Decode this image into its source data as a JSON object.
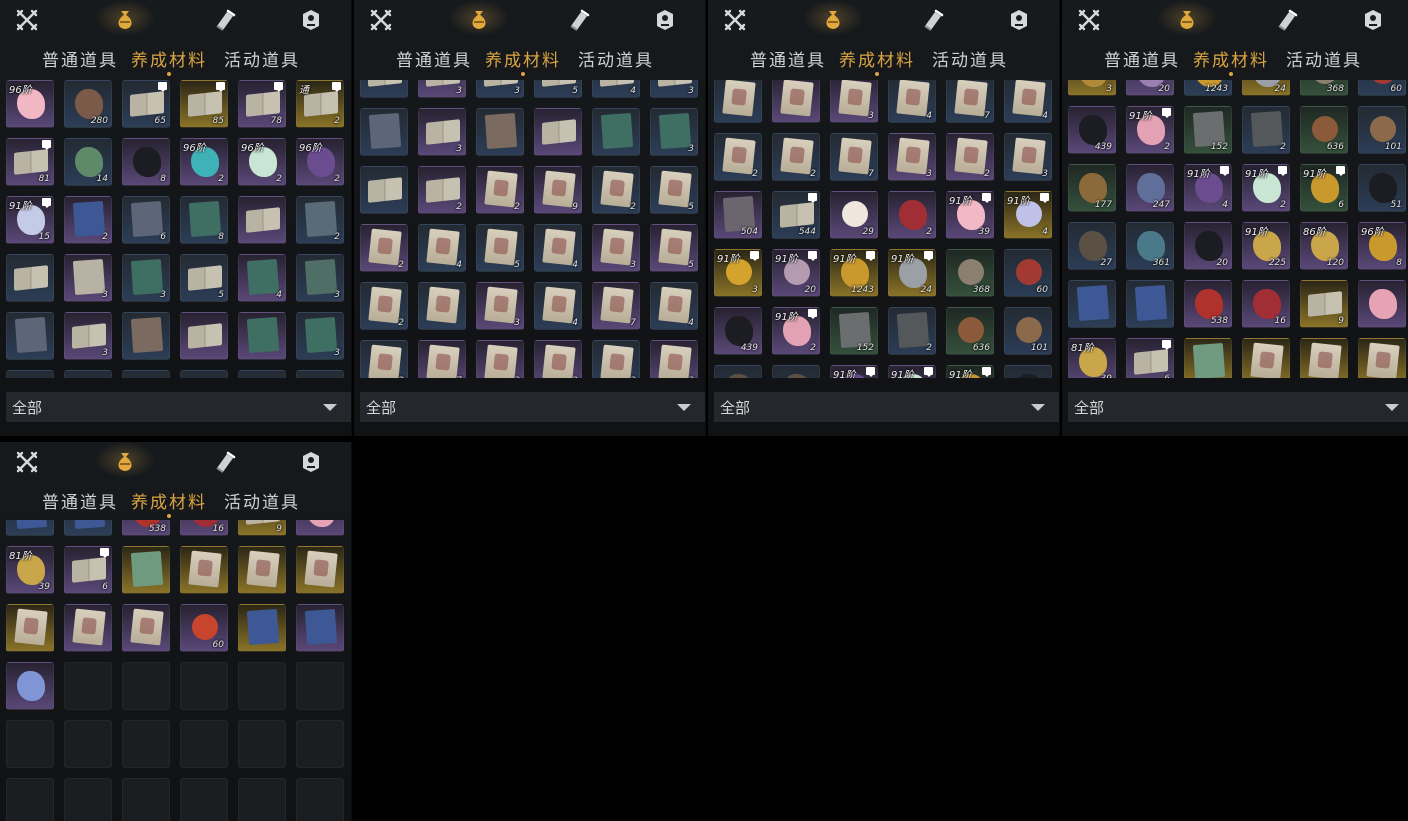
{
  "tabs": [
    "普通道具",
    "养成材料",
    "活动道具"
  ],
  "active_tab": 1,
  "top_icons": [
    {
      "name": "crossed-swords-icon"
    },
    {
      "name": "pouch-icon",
      "active": true
    },
    {
      "name": "scroll-brush-icon"
    },
    {
      "name": "shield-badge-icon"
    }
  ],
  "filter_label": "全部",
  "colors": {
    "active": "#d9a441",
    "text": "#cfd2d4",
    "panel_bg": "#15181b"
  },
  "panels": [
    {
      "items": [
        {
          "r": "purple",
          "a": "blob",
          "c": "#f2b7c4",
          "tier": "96阶"
        },
        {
          "r": "blue",
          "a": "blob",
          "c": "#7b5a49",
          "n": "280"
        },
        {
          "r": "blue",
          "a": "book",
          "n": "65",
          "badge": true
        },
        {
          "r": "gold",
          "a": "book",
          "n": "85",
          "badge": true
        },
        {
          "r": "purple",
          "a": "book",
          "n": "78",
          "badge": true
        },
        {
          "r": "gold",
          "a": "book",
          "n": "2",
          "badge": true,
          "tier": "通"
        },
        {
          "r": "purple",
          "a": "book",
          "n": "81",
          "badge": true
        },
        {
          "r": "blue",
          "a": "blob",
          "c": "#5f8a6a",
          "n": "14"
        },
        {
          "r": "purple",
          "a": "blob",
          "c": "#1b1d22",
          "n": "8"
        },
        {
          "r": "purple",
          "a": "blob",
          "c": "#3fb2b7",
          "n": "2",
          "tier": "96阶"
        },
        {
          "r": "purple",
          "a": "blob",
          "c": "#c9e6d4",
          "n": "2",
          "tier": "96阶"
        },
        {
          "r": "purple",
          "a": "blob",
          "c": "#6b4c8f",
          "n": "2",
          "tier": "96阶"
        },
        {
          "r": "purple",
          "a": "blob",
          "c": "#c4cbe6",
          "n": "15",
          "tier": "91阶",
          "badge": true
        },
        {
          "r": "purple",
          "a": "cover",
          "c": "#3e5896",
          "n": "2"
        },
        {
          "r": "blue",
          "a": "cover",
          "c": "#5d6678",
          "n": "6"
        },
        {
          "r": "blue",
          "a": "cover",
          "c": "#3f6f63",
          "n": "8"
        },
        {
          "r": "purple",
          "a": "book"
        },
        {
          "r": "blue",
          "a": "cover",
          "c": "#5a6b78",
          "n": "2"
        },
        {
          "r": "blue",
          "a": "book"
        },
        {
          "r": "purple",
          "a": "cover",
          "c": "#b8b2a5",
          "n": "3"
        },
        {
          "r": "blue",
          "a": "cover",
          "c": "#3f6f63",
          "n": "3"
        },
        {
          "r": "blue",
          "a": "book",
          "n": "5"
        },
        {
          "r": "purple",
          "a": "cover",
          "c": "#3f6f63",
          "n": "4"
        },
        {
          "r": "blue",
          "a": "cover",
          "c": "#4f6e66",
          "n": "3"
        },
        {
          "r": "blue",
          "a": "cover",
          "c": "#5d6678"
        },
        {
          "r": "purple",
          "a": "book",
          "n": "3"
        },
        {
          "r": "blue",
          "a": "cover",
          "c": "#7a6a60"
        },
        {
          "r": "purple",
          "a": "book"
        },
        {
          "r": "purple",
          "a": "cover",
          "c": "#3f6f63"
        },
        {
          "r": "blue",
          "a": "cover",
          "c": "#3f6f63",
          "n": "3"
        },
        {
          "r": "blue",
          "a": "book"
        },
        {
          "r": "blue",
          "a": "book"
        },
        {
          "r": "blue",
          "a": "book"
        },
        {
          "r": "blue",
          "a": "book"
        },
        {
          "r": "blue",
          "a": "book"
        },
        {
          "r": "blue",
          "a": "book"
        }
      ]
    },
    {
      "items": [
        {
          "r": "blue",
          "a": "book"
        },
        {
          "r": "purple",
          "a": "book",
          "n": "3"
        },
        {
          "r": "blue",
          "a": "book",
          "n": "3"
        },
        {
          "r": "blue",
          "a": "book",
          "n": "5"
        },
        {
          "r": "blue",
          "a": "book",
          "n": "4"
        },
        {
          "r": "blue",
          "a": "book",
          "n": "3"
        },
        {
          "r": "blue",
          "a": "cover",
          "c": "#5d6678"
        },
        {
          "r": "purple",
          "a": "book",
          "n": "3"
        },
        {
          "r": "blue",
          "a": "cover",
          "c": "#7a6a60"
        },
        {
          "r": "purple",
          "a": "book"
        },
        {
          "r": "blue",
          "a": "cover",
          "c": "#3f6f63"
        },
        {
          "r": "blue",
          "a": "cover",
          "c": "#3f6f63",
          "n": "3"
        },
        {
          "r": "blue",
          "a": "book"
        },
        {
          "r": "purple",
          "a": "book",
          "n": "2"
        },
        {
          "r": "purple",
          "a": "scroll",
          "n": "2"
        },
        {
          "r": "purple",
          "a": "scroll",
          "n": "9"
        },
        {
          "r": "blue",
          "a": "scroll",
          "n": "2"
        },
        {
          "r": "blue",
          "a": "scroll",
          "n": "5"
        },
        {
          "r": "purple",
          "a": "scroll",
          "n": "2"
        },
        {
          "r": "blue",
          "a": "scroll",
          "n": "4"
        },
        {
          "r": "blue",
          "a": "scroll",
          "n": "5"
        },
        {
          "r": "blue",
          "a": "scroll",
          "n": "4"
        },
        {
          "r": "purple",
          "a": "scroll",
          "n": "3"
        },
        {
          "r": "purple",
          "a": "scroll",
          "n": "5"
        },
        {
          "r": "blue",
          "a": "scroll",
          "n": "2"
        },
        {
          "r": "blue",
          "a": "scroll"
        },
        {
          "r": "purple",
          "a": "scroll",
          "n": "3"
        },
        {
          "r": "blue",
          "a": "scroll",
          "n": "4"
        },
        {
          "r": "purple",
          "a": "scroll",
          "n": "7"
        },
        {
          "r": "blue",
          "a": "scroll",
          "n": "4"
        },
        {
          "r": "blue",
          "a": "scroll",
          "n": "2"
        },
        {
          "r": "purple",
          "a": "scroll",
          "n": "7"
        },
        {
          "r": "purple",
          "a": "scroll",
          "n": "3"
        },
        {
          "r": "purple",
          "a": "scroll",
          "n": "2"
        },
        {
          "r": "blue",
          "a": "scroll",
          "n": "3"
        },
        {
          "r": "purple",
          "a": "scroll",
          "n": "3"
        }
      ]
    },
    {
      "items": [
        {
          "r": "blue",
          "a": "scroll"
        },
        {
          "r": "purple",
          "a": "scroll"
        },
        {
          "r": "purple",
          "a": "scroll",
          "n": "3"
        },
        {
          "r": "blue",
          "a": "scroll",
          "n": "4"
        },
        {
          "r": "blue",
          "a": "scroll",
          "n": "7"
        },
        {
          "r": "blue",
          "a": "scroll",
          "n": "4"
        },
        {
          "r": "blue",
          "a": "scroll",
          "n": "2"
        },
        {
          "r": "blue",
          "a": "scroll",
          "n": "2"
        },
        {
          "r": "blue",
          "a": "scroll",
          "n": "7"
        },
        {
          "r": "purple",
          "a": "scroll",
          "n": "3"
        },
        {
          "r": "purple",
          "a": "scroll",
          "n": "2"
        },
        {
          "r": "blue",
          "a": "scroll",
          "n": "3"
        },
        {
          "r": "purple",
          "a": "cover",
          "c": "#6b6570",
          "n": "504"
        },
        {
          "r": "blue",
          "a": "book",
          "n": "544",
          "badge": true
        },
        {
          "r": "purple",
          "a": "orb",
          "c": "#efe7dd",
          "n": "29"
        },
        {
          "r": "purple",
          "a": "blob",
          "c": "#a12e34",
          "n": "2"
        },
        {
          "r": "purple",
          "a": "blob",
          "c": "#f3b8c6",
          "n": "39",
          "tier": "91阶",
          "badge": true
        },
        {
          "r": "gold",
          "a": "orb",
          "c": "#bfc2e6",
          "n": "4",
          "tier": "91阶",
          "badge": true
        },
        {
          "r": "gold",
          "a": "orb",
          "c": "#d4a32e",
          "n": "3",
          "tier": "91阶",
          "badge": true
        },
        {
          "r": "purple",
          "a": "orb",
          "c": "#b59bb0",
          "n": "20",
          "tier": "91阶",
          "badge": true
        },
        {
          "r": "gold",
          "a": "blob",
          "c": "#c9992e",
          "n": "1243",
          "tier": "91阶",
          "badge": true
        },
        {
          "r": "gold",
          "a": "blob",
          "c": "#9aa0a6",
          "n": "24",
          "tier": "91阶",
          "badge": true
        },
        {
          "r": "green",
          "a": "orb",
          "c": "#8b7f70",
          "n": "368"
        },
        {
          "r": "blue",
          "a": "orb",
          "c": "#a33a32",
          "n": "60"
        },
        {
          "r": "purple",
          "a": "blob",
          "c": "#1b1d22",
          "n": "439"
        },
        {
          "r": "purple",
          "a": "blob",
          "c": "#e3a2b4",
          "n": "2",
          "tier": "91阶",
          "badge": true
        },
        {
          "r": "green",
          "a": "cover",
          "c": "#6b6e6f",
          "n": "152"
        },
        {
          "r": "blue",
          "a": "cover",
          "c": "#55585a",
          "n": "2"
        },
        {
          "r": "green",
          "a": "orb",
          "c": "#8a5a3a",
          "n": "636"
        },
        {
          "r": "blue",
          "a": "orb",
          "c": "#8a6a4a",
          "n": "101"
        },
        {
          "r": "blue",
          "a": "blob",
          "c": "#5a5044"
        },
        {
          "r": "blue",
          "a": "blob",
          "c": "#5a5044"
        },
        {
          "r": "purple",
          "a": "blob",
          "c": "#6b4c8f",
          "tier": "91阶",
          "badge": true
        },
        {
          "r": "purple",
          "a": "blob",
          "c": "#c9e6d4",
          "tier": "91阶",
          "badge": true
        },
        {
          "r": "green",
          "a": "blob",
          "c": "#c9992e",
          "tier": "91阶",
          "badge": true
        },
        {
          "r": "blue",
          "a": "blob",
          "c": "#1b1d22"
        }
      ]
    },
    {
      "items": [
        {
          "r": "gold",
          "a": "blob",
          "c": "#b08a3a",
          "n": "3"
        },
        {
          "r": "purple",
          "a": "blob",
          "c": "#9a7fb0",
          "n": "20"
        },
        {
          "r": "blue",
          "a": "blob",
          "c": "#c9992e",
          "n": "1243"
        },
        {
          "r": "gold",
          "a": "blob",
          "c": "#9aa0a6",
          "n": "24"
        },
        {
          "r": "green",
          "a": "orb",
          "c": "#8b7f70",
          "n": "368"
        },
        {
          "r": "blue",
          "a": "orb",
          "c": "#a33a32",
          "n": "60"
        },
        {
          "r": "purple",
          "a": "blob",
          "c": "#1b1d22",
          "n": "439"
        },
        {
          "r": "purple",
          "a": "blob",
          "c": "#e3a2b4",
          "n": "2",
          "tier": "91阶",
          "badge": true
        },
        {
          "r": "green",
          "a": "cover",
          "c": "#6b6e6f",
          "n": "152"
        },
        {
          "r": "blue",
          "a": "cover",
          "c": "#55585a",
          "n": "2"
        },
        {
          "r": "green",
          "a": "orb",
          "c": "#8a5a3a",
          "n": "636"
        },
        {
          "r": "blue",
          "a": "orb",
          "c": "#8a6a4a",
          "n": "101"
        },
        {
          "r": "green",
          "a": "blob",
          "c": "#8a6a3a",
          "n": "177"
        },
        {
          "r": "purple",
          "a": "blob",
          "c": "#5f6f9a",
          "n": "247"
        },
        {
          "r": "purple",
          "a": "blob",
          "c": "#6b4c8f",
          "n": "4",
          "tier": "91阶",
          "badge": true
        },
        {
          "r": "purple",
          "a": "blob",
          "c": "#c9e6d4",
          "n": "2",
          "tier": "91阶",
          "badge": true
        },
        {
          "r": "green",
          "a": "blob",
          "c": "#c9992e",
          "n": "6",
          "tier": "91阶",
          "badge": true
        },
        {
          "r": "blue",
          "a": "blob",
          "c": "#1b1d22",
          "n": "51"
        },
        {
          "r": "blue",
          "a": "blob",
          "c": "#5a5044",
          "n": "27"
        },
        {
          "r": "blue",
          "a": "blob",
          "c": "#4a7a8a",
          "n": "361"
        },
        {
          "r": "purple",
          "a": "blob",
          "c": "#1b1d22",
          "n": "20"
        },
        {
          "r": "purple",
          "a": "blob",
          "c": "#c9a64a",
          "n": "225",
          "tier": "91阶"
        },
        {
          "r": "purple",
          "a": "blob",
          "c": "#c9a64a",
          "n": "120",
          "tier": "86阶"
        },
        {
          "r": "purple",
          "a": "blob",
          "c": "#c9992e",
          "n": "8",
          "tier": "96阶"
        },
        {
          "r": "blue",
          "a": "cover",
          "c": "#3e5896"
        },
        {
          "r": "blue",
          "a": "cover",
          "c": "#3e5896"
        },
        {
          "r": "purple",
          "a": "blob",
          "c": "#b0322c",
          "n": "538"
        },
        {
          "r": "purple",
          "a": "blob",
          "c": "#a12e34",
          "n": "16"
        },
        {
          "r": "gold",
          "a": "book",
          "n": "9"
        },
        {
          "r": "purple",
          "a": "blob",
          "c": "#e6a3b6"
        },
        {
          "r": "purple",
          "a": "blob",
          "c": "#c9a64a",
          "n": "39",
          "tier": "81阶"
        },
        {
          "r": "purple",
          "a": "book",
          "n": "6",
          "badge": true
        },
        {
          "r": "gold",
          "a": "cover",
          "c": "#6f9a80"
        },
        {
          "r": "gold",
          "a": "scroll"
        },
        {
          "r": "gold",
          "a": "scroll"
        },
        {
          "r": "gold",
          "a": "scroll"
        }
      ]
    },
    {
      "items": [
        {
          "r": "blue",
          "a": "cover",
          "c": "#3e5896"
        },
        {
          "r": "blue",
          "a": "cover",
          "c": "#3e5896"
        },
        {
          "r": "purple",
          "a": "blob",
          "c": "#b0322c",
          "n": "538"
        },
        {
          "r": "purple",
          "a": "blob",
          "c": "#a12e34",
          "n": "16"
        },
        {
          "r": "gold",
          "a": "book",
          "n": "9"
        },
        {
          "r": "purple",
          "a": "blob",
          "c": "#e6a3b6"
        },
        {
          "r": "purple",
          "a": "blob",
          "c": "#c9a64a",
          "n": "39",
          "tier": "81阶"
        },
        {
          "r": "purple",
          "a": "book",
          "n": "6",
          "badge": true
        },
        {
          "r": "gold",
          "a": "cover",
          "c": "#6f9a80"
        },
        {
          "r": "gold",
          "a": "scroll"
        },
        {
          "r": "gold",
          "a": "scroll"
        },
        {
          "r": "gold",
          "a": "scroll"
        },
        {
          "r": "gold",
          "a": "scroll"
        },
        {
          "r": "purple",
          "a": "scroll"
        },
        {
          "r": "purple",
          "a": "scroll"
        },
        {
          "r": "purple",
          "a": "orb",
          "c": "#c7452c",
          "n": "60"
        },
        {
          "r": "gold",
          "a": "cover",
          "c": "#3e5896"
        },
        {
          "r": "purple",
          "a": "cover",
          "c": "#3e5896"
        },
        {
          "r": "purple",
          "a": "blob",
          "c": "#7f95d6"
        },
        {
          "r": "empty"
        },
        {
          "r": "empty"
        },
        {
          "r": "empty"
        },
        {
          "r": "empty"
        },
        {
          "r": "empty"
        },
        {
          "r": "empty"
        },
        {
          "r": "empty"
        },
        {
          "r": "empty"
        },
        {
          "r": "empty"
        },
        {
          "r": "empty"
        },
        {
          "r": "empty"
        },
        {
          "r": "empty"
        },
        {
          "r": "empty"
        },
        {
          "r": "empty"
        },
        {
          "r": "empty"
        },
        {
          "r": "empty"
        },
        {
          "r": "empty"
        }
      ]
    }
  ]
}
